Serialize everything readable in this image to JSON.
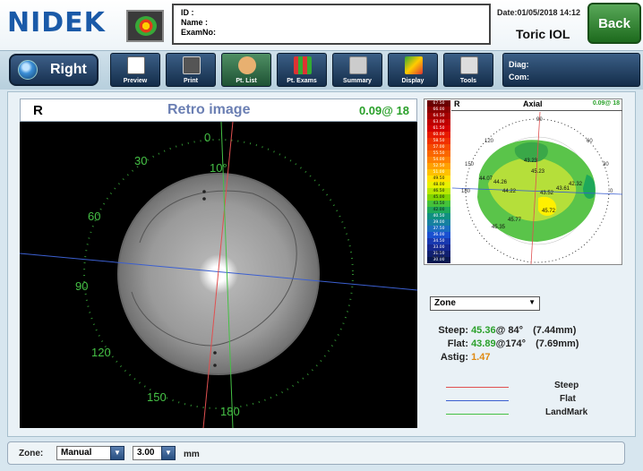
{
  "header": {
    "logo": "NIDEK",
    "patient": {
      "id_label": "ID :",
      "name_label": "Name :",
      "exam_label": "ExamNo:"
    },
    "date": "Date:01/05/2018 14:12",
    "mode": "Toric IOL",
    "back_label": "Back"
  },
  "toolbar": {
    "eye_label": "Right",
    "buttons": [
      {
        "label": "Preview",
        "icon": "magnifier-icon"
      },
      {
        "label": "Print",
        "icon": "printer-icon"
      },
      {
        "label": "Pt. List",
        "icon": "person-icon"
      },
      {
        "label": "Pt. Exams",
        "icon": "exams-icon"
      },
      {
        "label": "Summary",
        "icon": "summary-icon"
      },
      {
        "label": "Display",
        "icon": "display-icon"
      },
      {
        "label": "Tools",
        "icon": "tools-icon"
      }
    ],
    "diag_label": "Diag:",
    "com_label": "Com:"
  },
  "retro": {
    "eye": "R",
    "title": "Retro image",
    "value": "0.09@ 18",
    "protractor_labels": [
      "0",
      "10°",
      "30",
      "60",
      "90",
      "120",
      "150",
      "180"
    ]
  },
  "topography": {
    "eye": "R",
    "title": "Axial",
    "value": "0.09@ 18",
    "scale_values": [
      "67.50",
      "66.00",
      "64.50",
      "63.00",
      "61.50",
      "60.00",
      "58.50",
      "57.00",
      "55.50",
      "54.00",
      "52.50",
      "51.00",
      "49.50",
      "48.00",
      "46.50",
      "45.00",
      "43.50",
      "42.00",
      "40.50",
      "39.00",
      "37.50",
      "36.00",
      "34.50",
      "33.00",
      "31.50",
      "30.00"
    ],
    "scale_colors": [
      "#6b0000",
      "#8c0000",
      "#a50000",
      "#bf0000",
      "#d40000",
      "#e61a00",
      "#f03000",
      "#f64b00",
      "#fa6600",
      "#ff8000",
      "#ffa000",
      "#ffc000",
      "#ffe000",
      "#e8f000",
      "#b8e600",
      "#7fd400",
      "#44c23a",
      "#1ea85a",
      "#0f9080",
      "#1580a0",
      "#1a6cc0",
      "#1a50d0",
      "#1838b0",
      "#152890",
      "#102070",
      "#081850"
    ],
    "scale_foot": [
      "Abs",
      "S-K 1.5"
    ],
    "map_labels": [
      "43.23",
      "45.23",
      "44.07",
      "44.26",
      "44.22",
      "43.52",
      "43.61",
      "42.32",
      "45.72",
      "45.77",
      "45.35"
    ],
    "ring_labels": [
      "150",
      "180",
      "120",
      "30",
      "60",
      "90",
      "0"
    ]
  },
  "zone_select": "Zone",
  "measurements": {
    "steep": {
      "label": "Steep:",
      "value": "45.36",
      "axis": "@ 84°",
      "mm": "(7.44mm)"
    },
    "flat": {
      "label": "Flat:",
      "value": "43.89",
      "axis": "@174°",
      "mm": "(7.69mm)"
    },
    "astig": {
      "label": "Astig:",
      "value": "1.47"
    }
  },
  "legend": [
    {
      "label": "Steep",
      "color": "#e05050"
    },
    {
      "label": "Flat",
      "color": "#3b5fd0"
    },
    {
      "label": "LandMark",
      "color": "#45c045"
    }
  ],
  "bottom": {
    "zone_label": "Zone:",
    "zone_value": "Manual",
    "size_value": "3.00",
    "unit": "mm"
  }
}
